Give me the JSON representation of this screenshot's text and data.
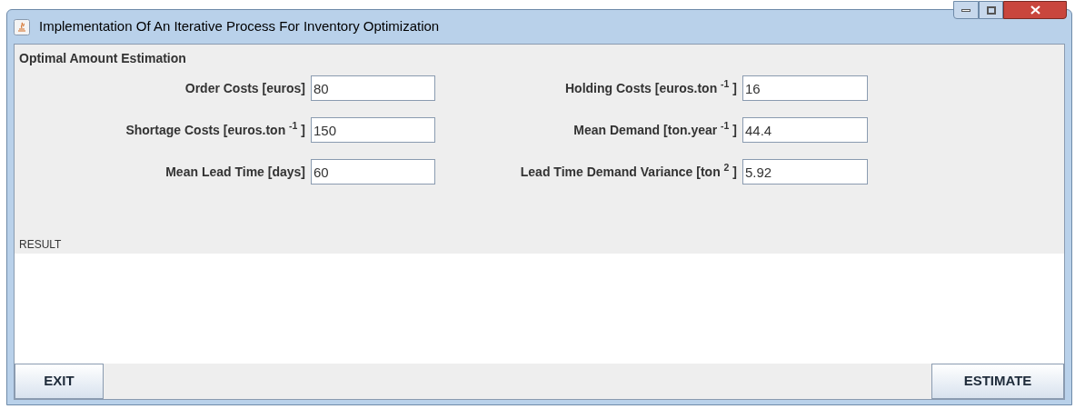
{
  "window": {
    "title": "Implementation Of An Iterative Process For Inventory Optimization"
  },
  "section_title": "Optimal Amount Estimation",
  "fields": [
    {
      "label": "Order Costs [euros]",
      "value": "80"
    },
    {
      "label": "Holding Costs [euros.ton $^{-1}$ ]",
      "value": "16"
    },
    {
      "label": "Shortage Costs [euros.ton $^{-1}$ ]",
      "value": "150"
    },
    {
      "label": "Mean Demand [ton.year $^{-1}$ ]",
      "value": "44.4"
    },
    {
      "label": "Mean Lead Time [days]",
      "value": "60"
    },
    {
      "label": "Lead Time Demand Variance [ton $^{2}$ ]",
      "value": "5.92"
    }
  ],
  "result_label": "RESULT",
  "buttons": [
    {
      "label": "EXIT"
    },
    {
      "label": "ESTIMATE"
    }
  ]
}
